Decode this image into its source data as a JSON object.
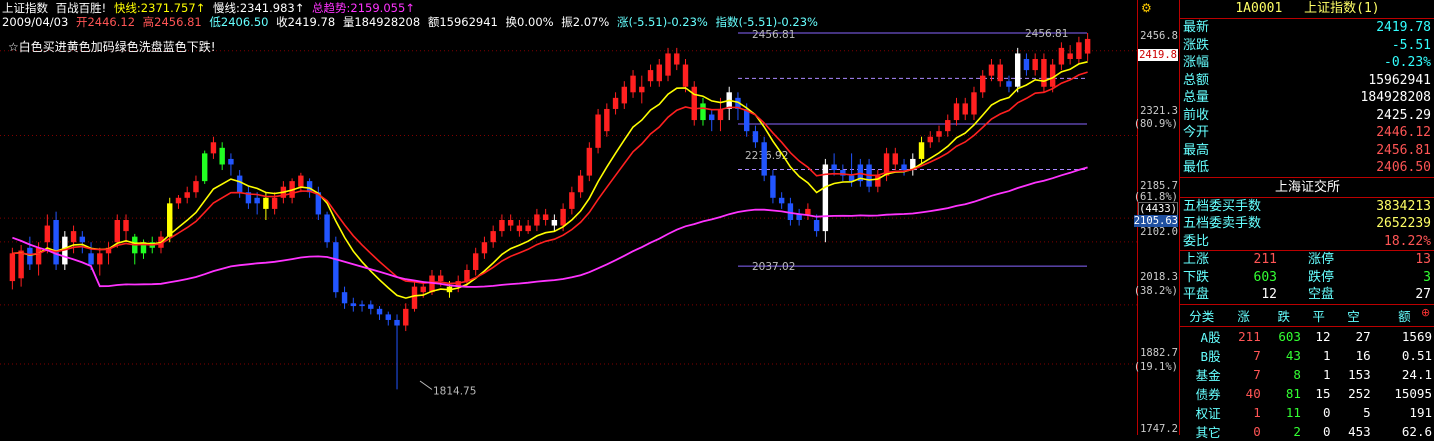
{
  "header": {
    "name": "上证指数",
    "formula": "百战百胜!",
    "fast_label": "快线:2371.757↑",
    "slow_label": "慢线:2341.983↑",
    "trend_label": "总趋势:2159.055↑",
    "date": "2009/04/03",
    "open": "开2446.12",
    "high": "高2456.81",
    "low": "低2406.50",
    "close": "收2419.78",
    "volume": "量184928208",
    "amount": "额15962941",
    "turnover": "换0.00%",
    "amplitude": "振2.07%",
    "change": "涨(-5.51)-0.23%",
    "index_change": "指数(-5.51)-0.23%"
  },
  "note": "☆白色买进黄色加码绿色洗盘蓝色下跌!",
  "colors": {
    "up": "#ff2020",
    "down": "#2255ff",
    "buy": "#ffffff",
    "add": "#ffff00",
    "wash": "#22ff22",
    "fast": "#ffff00",
    "slow": "#ff2020",
    "trend": "#ff33ff"
  },
  "axis": {
    "labels": [
      "2456.8",
      "2419.8",
      "2321.3",
      "(80.9%)",
      "2185.7",
      "(61.8%)",
      "(4433)",
      "2105.63",
      "2102.0",
      "2018.3",
      "(38.2%)",
      "1882.7",
      "(19.1%)",
      "1747.2"
    ]
  },
  "chart_data": {
    "type": "candlestick",
    "y_range": [
      1747.2,
      2456.8
    ],
    "annotations": [
      "2456.81",
      "2456.81",
      "2236.92",
      "2037.02",
      "1814.75"
    ],
    "hlines": [
      2456.81,
      2375.0,
      2293.0,
      2211.0,
      2037.02
    ],
    "candles": [
      [
        2010,
        2060,
        1995,
        2070,
        "up"
      ],
      [
        2015,
        2065,
        2000,
        2075,
        "up"
      ],
      [
        2070,
        2040,
        2030,
        2090,
        "down"
      ],
      [
        2040,
        2070,
        2020,
        2080,
        "up"
      ],
      [
        2080,
        2110,
        2060,
        2130,
        "up"
      ],
      [
        2120,
        2040,
        2030,
        2135,
        "down"
      ],
      [
        2040,
        2090,
        2030,
        2100,
        "buy"
      ],
      [
        2080,
        2100,
        2060,
        2110,
        "up"
      ],
      [
        2090,
        2080,
        2060,
        2100,
        "down"
      ],
      [
        2060,
        2040,
        2030,
        2080,
        "down"
      ],
      [
        2040,
        2060,
        2020,
        2070,
        "up"
      ],
      [
        2060,
        2070,
        2040,
        2080,
        "up"
      ],
      [
        2080,
        2120,
        2070,
        2130,
        "up"
      ],
      [
        2120,
        2100,
        2080,
        2130,
        "up"
      ],
      [
        2090,
        2060,
        2040,
        2095,
        "wash"
      ],
      [
        2060,
        2080,
        2050,
        2085,
        "wash"
      ],
      [
        2080,
        2070,
        2060,
        2090,
        "wash"
      ],
      [
        2070,
        2090,
        2060,
        2100,
        "up"
      ],
      [
        2090,
        2150,
        2080,
        2160,
        "add"
      ],
      [
        2150,
        2160,
        2140,
        2165,
        "up"
      ],
      [
        2160,
        2170,
        2150,
        2180,
        "up"
      ],
      [
        2170,
        2190,
        2160,
        2200,
        "up"
      ],
      [
        2190,
        2240,
        2185,
        2245,
        "wash"
      ],
      [
        2240,
        2260,
        2230,
        2270,
        "up"
      ],
      [
        2250,
        2220,
        2210,
        2260,
        "wash"
      ],
      [
        2220,
        2230,
        2200,
        2240,
        "down"
      ],
      [
        2200,
        2170,
        2160,
        2210,
        "down"
      ],
      [
        2170,
        2150,
        2140,
        2180,
        "down"
      ],
      [
        2150,
        2160,
        2130,
        2170,
        "down"
      ],
      [
        2160,
        2140,
        2120,
        2170,
        "add"
      ],
      [
        2140,
        2160,
        2130,
        2170,
        "up"
      ],
      [
        2160,
        2180,
        2150,
        2190,
        "up"
      ],
      [
        2160,
        2190,
        2150,
        2195,
        "up"
      ],
      [
        2180,
        2200,
        2170,
        2205,
        "up"
      ],
      [
        2190,
        2170,
        2160,
        2195,
        "down"
      ],
      [
        2170,
        2130,
        2120,
        2180,
        "down"
      ],
      [
        2130,
        2080,
        2070,
        2135,
        "down"
      ],
      [
        2080,
        1990,
        1980,
        2090,
        "down"
      ],
      [
        1990,
        1970,
        1960,
        2000,
        "down"
      ],
      [
        1970,
        1965,
        1955,
        1980,
        "down"
      ],
      [
        1965,
        1968,
        1955,
        1975,
        "down"
      ],
      [
        1968,
        1960,
        1950,
        1975,
        "down"
      ],
      [
        1960,
        1950,
        1940,
        1965,
        "down"
      ],
      [
        1950,
        1940,
        1930,
        1955,
        "down"
      ],
      [
        1940,
        1930,
        1815,
        1950,
        "down"
      ],
      [
        1930,
        1960,
        1920,
        1970,
        "up"
      ],
      [
        1960,
        2000,
        1955,
        2010,
        "up"
      ],
      [
        2000,
        1990,
        1980,
        2010,
        "up"
      ],
      [
        1990,
        2020,
        1985,
        2030,
        "up"
      ],
      [
        2020,
        2010,
        2000,
        2030,
        "up"
      ],
      [
        2000,
        1990,
        1980,
        2010,
        "add"
      ],
      [
        2000,
        2010,
        1990,
        2020,
        "up"
      ],
      [
        2010,
        2030,
        2000,
        2040,
        "up"
      ],
      [
        2030,
        2060,
        2020,
        2070,
        "up"
      ],
      [
        2060,
        2080,
        2050,
        2090,
        "up"
      ],
      [
        2080,
        2100,
        2070,
        2110,
        "up"
      ],
      [
        2100,
        2120,
        2090,
        2130,
        "up"
      ],
      [
        2120,
        2110,
        2100,
        2130,
        "up"
      ],
      [
        2110,
        2100,
        2090,
        2120,
        "up"
      ],
      [
        2100,
        2110,
        2095,
        2120,
        "up"
      ],
      [
        2110,
        2130,
        2100,
        2140,
        "up"
      ],
      [
        2130,
        2120,
        2110,
        2140,
        "up"
      ],
      [
        2120,
        2110,
        2100,
        2130,
        "buy"
      ],
      [
        2110,
        2140,
        2100,
        2150,
        "up"
      ],
      [
        2140,
        2170,
        2130,
        2180,
        "up"
      ],
      [
        2170,
        2200,
        2160,
        2210,
        "up"
      ],
      [
        2200,
        2250,
        2190,
        2260,
        "up"
      ],
      [
        2250,
        2310,
        2240,
        2320,
        "up"
      ],
      [
        2280,
        2320,
        2270,
        2330,
        "up"
      ],
      [
        2320,
        2340,
        2310,
        2350,
        "up"
      ],
      [
        2330,
        2360,
        2320,
        2370,
        "up"
      ],
      [
        2350,
        2380,
        2340,
        2390,
        "up"
      ],
      [
        2360,
        2350,
        2330,
        2380,
        "up"
      ],
      [
        2370,
        2390,
        2360,
        2400,
        "up"
      ],
      [
        2400,
        2370,
        2360,
        2410,
        "up"
      ],
      [
        2380,
        2420,
        2370,
        2430,
        "up"
      ],
      [
        2420,
        2400,
        2390,
        2430,
        "up"
      ],
      [
        2400,
        2360,
        2350,
        2410,
        "up"
      ],
      [
        2360,
        2300,
        2290,
        2370,
        "up"
      ],
      [
        2300,
        2330,
        2290,
        2340,
        "wash"
      ],
      [
        2310,
        2300,
        2280,
        2320,
        "down"
      ],
      [
        2300,
        2320,
        2280,
        2340,
        "up"
      ],
      [
        2320,
        2350,
        2300,
        2360,
        "buy"
      ],
      [
        2340,
        2320,
        2300,
        2350,
        "down"
      ],
      [
        2320,
        2280,
        2270,
        2330,
        "down"
      ],
      [
        2280,
        2260,
        2250,
        2290,
        "down"
      ],
      [
        2260,
        2200,
        2190,
        2270,
        "down"
      ],
      [
        2200,
        2160,
        2150,
        2210,
        "down"
      ],
      [
        2160,
        2150,
        2140,
        2170,
        "down"
      ],
      [
        2150,
        2120,
        2110,
        2160,
        "down"
      ],
      [
        2120,
        2130,
        2110,
        2140,
        "down"
      ],
      [
        2130,
        2140,
        2120,
        2150,
        "up"
      ],
      [
        2120,
        2100,
        2090,
        2130,
        "down"
      ],
      [
        2100,
        2220,
        2080,
        2230,
        "buy"
      ],
      [
        2220,
        2210,
        2200,
        2240,
        "down"
      ],
      [
        2210,
        2200,
        2190,
        2220,
        "down"
      ],
      [
        2200,
        2190,
        2180,
        2240,
        "down"
      ],
      [
        2190,
        2220,
        2180,
        2230,
        "down"
      ],
      [
        2220,
        2180,
        2170,
        2230,
        "down"
      ],
      [
        2180,
        2200,
        2170,
        2210,
        "up"
      ],
      [
        2200,
        2240,
        2190,
        2250,
        "up"
      ],
      [
        2240,
        2220,
        2210,
        2250,
        "up"
      ],
      [
        2220,
        2210,
        2200,
        2230,
        "down"
      ],
      [
        2210,
        2230,
        2200,
        2240,
        "buy"
      ],
      [
        2230,
        2260,
        2220,
        2270,
        "add"
      ],
      [
        2260,
        2270,
        2250,
        2280,
        "up"
      ],
      [
        2270,
        2280,
        2260,
        2290,
        "up"
      ],
      [
        2280,
        2300,
        2270,
        2310,
        "up"
      ],
      [
        2300,
        2330,
        2290,
        2340,
        "up"
      ],
      [
        2330,
        2310,
        2300,
        2340,
        "up"
      ],
      [
        2310,
        2350,
        2300,
        2360,
        "up"
      ],
      [
        2350,
        2380,
        2340,
        2390,
        "up"
      ],
      [
        2380,
        2400,
        2370,
        2410,
        "up"
      ],
      [
        2400,
        2370,
        2360,
        2410,
        "up"
      ],
      [
        2370,
        2360,
        2350,
        2380,
        "down"
      ],
      [
        2360,
        2420,
        2350,
        2430,
        "buy"
      ],
      [
        2410,
        2390,
        2380,
        2420,
        "down"
      ],
      [
        2390,
        2410,
        2380,
        2420,
        "up"
      ],
      [
        2410,
        2360,
        2350,
        2420,
        "up"
      ],
      [
        2360,
        2400,
        2350,
        2410,
        "up"
      ],
      [
        2400,
        2430,
        2390,
        2440,
        "up"
      ],
      [
        2420,
        2410,
        2400,
        2435,
        "up"
      ],
      [
        2410,
        2440,
        2400,
        2450,
        "up"
      ],
      [
        2446.12,
        2419.78,
        2406.5,
        2456.81,
        "up"
      ]
    ]
  },
  "panel": {
    "code": "1A0001",
    "title": "上证指数(1)",
    "quote": [
      {
        "k": "最新",
        "v": "2419.78",
        "c": "#33ffff"
      },
      {
        "k": "涨跌",
        "v": "-5.51",
        "c": "#33ffff"
      },
      {
        "k": "涨幅",
        "v": "-0.23%",
        "c": "#33ffff"
      },
      {
        "k": "总额",
        "v": "15962941",
        "c": "#ffffff"
      },
      {
        "k": "总量",
        "v": "184928208",
        "c": "#ffffff"
      },
      {
        "k": "前收",
        "v": "2425.29",
        "c": "#ffffff"
      },
      {
        "k": "今开",
        "v": "2446.12",
        "c": "#ff5555"
      },
      {
        "k": "最高",
        "v": "2456.81",
        "c": "#ff5555"
      },
      {
        "k": "最低",
        "v": "2406.50",
        "c": "#ff5555"
      }
    ],
    "exchange": "上海证交所",
    "orders": [
      {
        "k": "五档委买手数",
        "v": "3834213",
        "c": "#ffff66"
      },
      {
        "k": "五档委卖手数",
        "v": "2652239",
        "c": "#ffff66"
      },
      {
        "k": "委比",
        "v": "18.22%",
        "c": "#ff5555"
      }
    ],
    "breadth": [
      {
        "a": "上涨",
        "b": "211",
        "c": "涨停",
        "d": "13",
        "bc": "#ff5555",
        "dc": "#ff5555"
      },
      {
        "a": "下跌",
        "b": "603",
        "c": "跌停",
        "d": "3",
        "bc": "#33ff33",
        "dc": "#33ff33"
      },
      {
        "a": "平盘",
        "b": "12",
        "c": "空盘",
        "d": "27",
        "bc": "#ffffff",
        "dc": "#ffffff"
      }
    ],
    "class_headers": [
      "分类",
      "涨",
      "跌",
      "平",
      "空",
      "额"
    ],
    "classes": [
      [
        "A股",
        "211",
        "603",
        "12",
        "27",
        "1569"
      ],
      [
        "B股",
        "7",
        "43",
        "1",
        "16",
        "0.51"
      ],
      [
        "基金",
        "7",
        "8",
        "1",
        "153",
        "24.1"
      ],
      [
        "债券",
        "40",
        "81",
        "15",
        "252",
        "15095"
      ],
      [
        "权证",
        "1",
        "11",
        "0",
        "5",
        "191"
      ],
      [
        "其它",
        "0",
        "2",
        "0",
        "453",
        "62.6"
      ]
    ]
  }
}
